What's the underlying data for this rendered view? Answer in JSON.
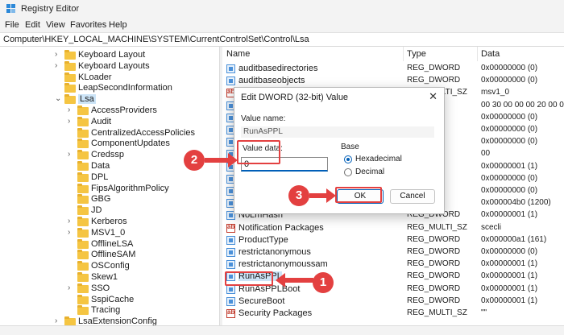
{
  "window": {
    "title": "Registry Editor",
    "icon": "registry-editor-icon"
  },
  "menu": [
    "File",
    "Edit",
    "View",
    "Favorites",
    "Help"
  ],
  "address": "Computer\\HKEY_LOCAL_MACHINE\\SYSTEM\\CurrentControlSet\\Control\\Lsa",
  "tree": [
    {
      "label": "Keyboard Layout",
      "expander": "›"
    },
    {
      "label": "Keyboard Layouts",
      "expander": "›"
    },
    {
      "label": "KLoader",
      "expander": ""
    },
    {
      "label": "LeapSecondInformation",
      "expander": ""
    },
    {
      "label": "Lsa",
      "expander": "⌄",
      "selected": true
    },
    {
      "label": "AccessProviders",
      "expander": "›"
    },
    {
      "label": "Audit",
      "expander": "›"
    },
    {
      "label": "CentralizedAccessPolicies",
      "expander": ""
    },
    {
      "label": "ComponentUpdates",
      "expander": ""
    },
    {
      "label": "Credssp",
      "expander": "›"
    },
    {
      "label": "Data",
      "expander": ""
    },
    {
      "label": "DPL",
      "expander": ""
    },
    {
      "label": "FipsAlgorithmPolicy",
      "expander": ""
    },
    {
      "label": "GBG",
      "expander": ""
    },
    {
      "label": "JD",
      "expander": ""
    },
    {
      "label": "Kerberos",
      "expander": "›"
    },
    {
      "label": "MSV1_0",
      "expander": "›"
    },
    {
      "label": "OfflineLSA",
      "expander": ""
    },
    {
      "label": "OfflineSAM",
      "expander": ""
    },
    {
      "label": "OSConfig",
      "expander": ""
    },
    {
      "label": "Skew1",
      "expander": ""
    },
    {
      "label": "SSO",
      "expander": "›"
    },
    {
      "label": "SspiCache",
      "expander": ""
    },
    {
      "label": "Tracing",
      "expander": ""
    },
    {
      "label": "LsaExtensionConfig",
      "expander": "›"
    }
  ],
  "columns": {
    "name": "Name",
    "type": "Type",
    "data": "Data"
  },
  "values": [
    {
      "name": "auditbasedirectories",
      "type": "REG_DWORD",
      "data": "0x00000000 (0)",
      "kind": "dw"
    },
    {
      "name": "auditbaseobjects",
      "type": "REG_DWORD",
      "data": "0x00000000 (0)",
      "kind": "dw"
    },
    {
      "name": "",
      "type": "REG_MULTI_SZ",
      "data": "msv1_0",
      "kind": "sz"
    },
    {
      "name": "",
      "type": "RY",
      "data": "00 30 00 00 00 20 00 00",
      "kind": "dw"
    },
    {
      "name": "",
      "type": "ORD",
      "data": "0x00000000 (0)",
      "kind": "dw"
    },
    {
      "name": "",
      "type": "ORD",
      "data": "0x00000000 (0)",
      "kind": "dw"
    },
    {
      "name": "",
      "type": "ORD",
      "data": "0x00000000 (0)",
      "kind": "dw"
    },
    {
      "name": "",
      "type": "RY",
      "data": "00",
      "kind": "dw"
    },
    {
      "name": "",
      "type": "ORD",
      "data": "0x00000001 (1)",
      "kind": "dw"
    },
    {
      "name": "",
      "type": "ORD",
      "data": "0x00000000 (0)",
      "kind": "dw"
    },
    {
      "name": "",
      "type": "ORD",
      "data": "0x00000000 (0)",
      "kind": "dw"
    },
    {
      "name": "",
      "type": "ORD",
      "data": "0x000004b0 (1200)",
      "kind": "dw"
    },
    {
      "name": "NoLmHash",
      "type": "REG_DWORD",
      "data": "0x00000001 (1)",
      "kind": "dw"
    },
    {
      "name": "Notification Packages",
      "type": "REG_MULTI_SZ",
      "data": "scecli",
      "kind": "sz"
    },
    {
      "name": "ProductType",
      "type": "REG_DWORD",
      "data": "0x000000a1 (161)",
      "kind": "dw"
    },
    {
      "name": "restrictanonymous",
      "type": "REG_DWORD",
      "data": "0x00000000 (0)",
      "kind": "dw"
    },
    {
      "name": "restrictanonymoussam",
      "type": "REG_DWORD",
      "data": "0x00000001 (1)",
      "kind": "dw"
    },
    {
      "name": "RunAsPPL",
      "type": "REG_DWORD",
      "data": "0x00000001 (1)",
      "kind": "dw",
      "selected": true
    },
    {
      "name": "RunAsPPLBoot",
      "type": "REG_DWORD",
      "data": "0x00000001 (1)",
      "kind": "dw"
    },
    {
      "name": "SecureBoot",
      "type": "REG_DWORD",
      "data": "0x00000001 (1)",
      "kind": "dw"
    },
    {
      "name": "Security Packages",
      "type": "REG_MULTI_SZ",
      "data": "\"\"",
      "kind": "sz"
    }
  ],
  "dialog": {
    "title": "Edit DWORD (32-bit) Value",
    "close_glyph": "✕",
    "value_name_label": "Value name:",
    "value_name": "RunAsPPL",
    "value_data_label": "Value data:",
    "value_data": "0",
    "base_label": "Base",
    "hex_label": "Hexadecimal",
    "dec_label": "Decimal",
    "selected_base": "Hexadecimal",
    "ok_label": "OK",
    "cancel_label": "Cancel"
  },
  "callouts": {
    "one": "1",
    "two": "2",
    "three": "3",
    "color": "#e34040"
  }
}
